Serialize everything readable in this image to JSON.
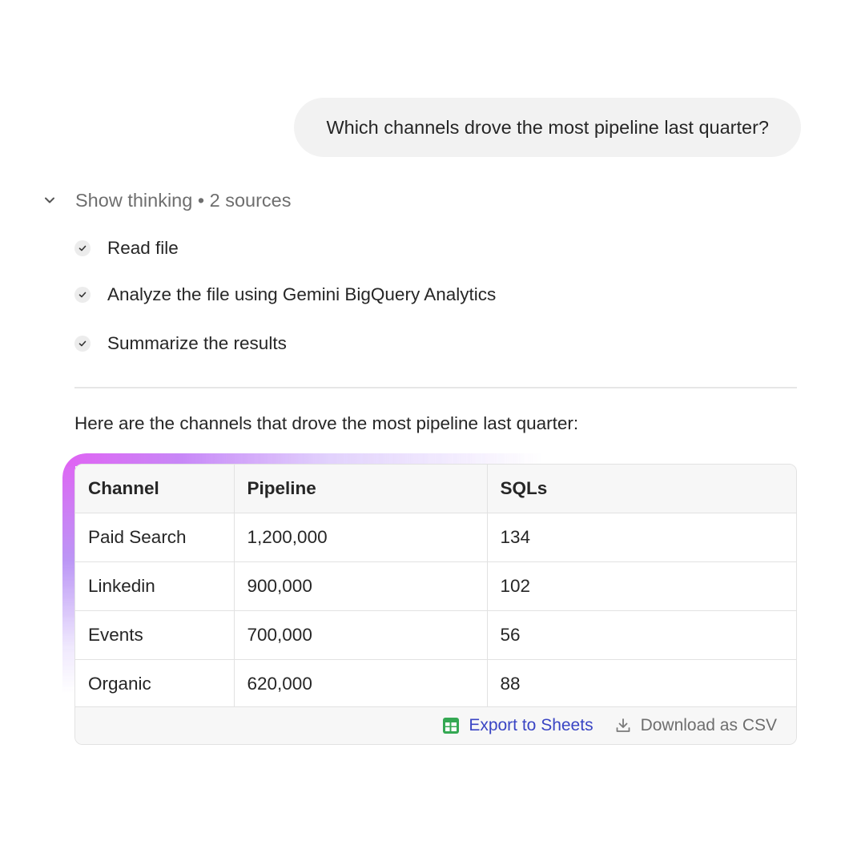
{
  "prompt": {
    "text": "Which channels drove the most pipeline last quarter?"
  },
  "thinking": {
    "toggle_label": "Show thinking • 2 sources",
    "expanded": true,
    "steps": [
      {
        "label": "Read file",
        "done": true
      },
      {
        "label": "Analyze the file using Gemini BigQuery Analytics",
        "done": true
      },
      {
        "label": "Summarize the results",
        "done": true
      }
    ]
  },
  "response": {
    "intro": "Here are the channels that drove the most pipeline last quarter:",
    "table": {
      "headers": [
        "Channel",
        "Pipeline",
        "SQLs"
      ],
      "rows": [
        [
          "Paid Search",
          "1,200,000",
          "134"
        ],
        [
          "Linkedin",
          "900,000",
          "102"
        ],
        [
          "Events",
          "700,000",
          "56"
        ],
        [
          "Organic",
          "620,000",
          "88"
        ]
      ]
    },
    "actions": {
      "export_label": "Export to Sheets",
      "export_icon": "sheets-icon",
      "download_label": "Download as CSV",
      "download_icon": "download-icon"
    }
  },
  "colors": {
    "accent_link": "#3a45c4",
    "sheets_green": "#34a853",
    "gradient_start": "#dd52f2",
    "gradient_mid": "#b58cf5"
  }
}
